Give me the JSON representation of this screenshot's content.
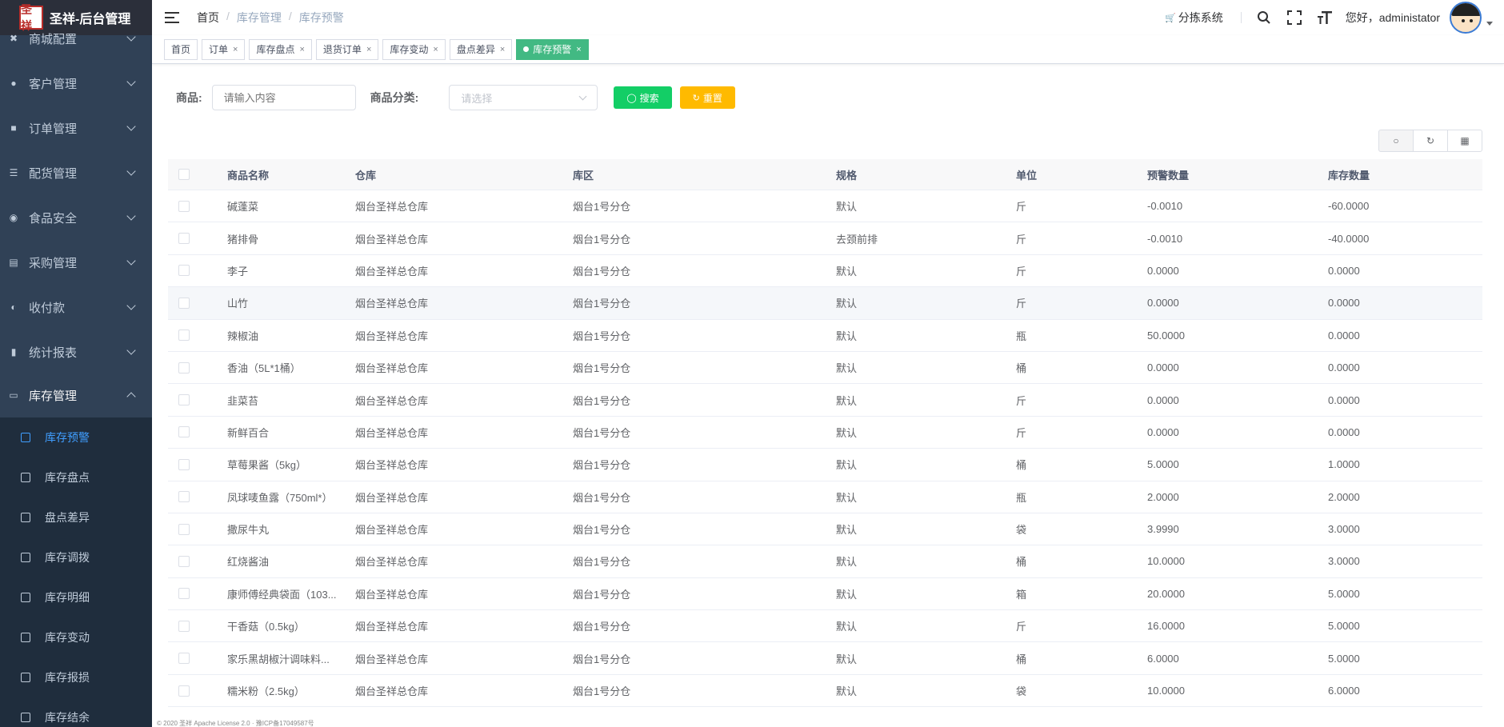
{
  "app": {
    "title": "圣祥-后台管理",
    "logo_text": "圣祥"
  },
  "sidebar": {
    "items": [
      {
        "label": "商城配置",
        "icon": "settings-icon"
      },
      {
        "label": "客户管理",
        "icon": "user-icon"
      },
      {
        "label": "订单管理",
        "icon": "lock-icon"
      },
      {
        "label": "配货管理",
        "icon": "list-icon"
      },
      {
        "label": "食品安全",
        "icon": "palette-icon"
      },
      {
        "label": "采购管理",
        "icon": "doc-icon"
      },
      {
        "label": "收付款",
        "icon": "coin-icon"
      },
      {
        "label": "统计报表",
        "icon": "chart-icon"
      },
      {
        "label": "库存管理",
        "icon": "monitor-icon"
      }
    ],
    "subitems": [
      {
        "label": "库存预警",
        "active": true
      },
      {
        "label": "库存盘点"
      },
      {
        "label": "盘点差异"
      },
      {
        "label": "库存调拨"
      },
      {
        "label": "库存明细"
      },
      {
        "label": "库存变动"
      },
      {
        "label": "库存报损"
      },
      {
        "label": "库存结余"
      }
    ]
  },
  "header": {
    "breadcrumb": [
      "首页",
      "库存管理",
      "库存预警"
    ],
    "system_link": "分拣系统",
    "greeting": "您好，administator"
  },
  "tags": [
    {
      "label": "首页",
      "closable": false
    },
    {
      "label": "订单",
      "closable": true
    },
    {
      "label": "库存盘点",
      "closable": true
    },
    {
      "label": "退货订单",
      "closable": true
    },
    {
      "label": "库存变动",
      "closable": true
    },
    {
      "label": "盘点差异",
      "closable": true
    },
    {
      "label": "库存预警",
      "closable": true,
      "active": true
    }
  ],
  "search": {
    "product_label": "商品:",
    "product_placeholder": "请输入内容",
    "category_label": "商品分类:",
    "category_placeholder": "请选择",
    "search_button": "搜索",
    "reset_button": "重置"
  },
  "table": {
    "columns": [
      "商品名称",
      "仓库",
      "库区",
      "规格",
      "单位",
      "预警数量",
      "库存数量"
    ],
    "rows": [
      [
        "碱蓬菜",
        "烟台圣祥总仓库",
        "烟台1号分仓",
        "默认",
        "斤",
        "-0.0010",
        "-60.0000"
      ],
      [
        "猪排骨",
        "烟台圣祥总仓库",
        "烟台1号分仓",
        "去颈前排",
        "斤",
        "-0.0010",
        "-40.0000"
      ],
      [
        "李子",
        "烟台圣祥总仓库",
        "烟台1号分仓",
        "默认",
        "斤",
        "0.0000",
        "0.0000"
      ],
      [
        "山竹",
        "烟台圣祥总仓库",
        "烟台1号分仓",
        "默认",
        "斤",
        "0.0000",
        "0.0000"
      ],
      [
        "辣椒油",
        "烟台圣祥总仓库",
        "烟台1号分仓",
        "默认",
        "瓶",
        "50.0000",
        "0.0000"
      ],
      [
        "香油（5L*1桶）",
        "烟台圣祥总仓库",
        "烟台1号分仓",
        "默认",
        "桶",
        "0.0000",
        "0.0000"
      ],
      [
        "韭菜苔",
        "烟台圣祥总仓库",
        "烟台1号分仓",
        "默认",
        "斤",
        "0.0000",
        "0.0000"
      ],
      [
        "新鲜百合",
        "烟台圣祥总仓库",
        "烟台1号分仓",
        "默认",
        "斤",
        "0.0000",
        "0.0000"
      ],
      [
        "草莓果酱（5kg）",
        "烟台圣祥总仓库",
        "烟台1号分仓",
        "默认",
        "桶",
        "5.0000",
        "1.0000"
      ],
      [
        "凤球唛鱼露（750ml*）",
        "烟台圣祥总仓库",
        "烟台1号分仓",
        "默认",
        "瓶",
        "2.0000",
        "2.0000"
      ],
      [
        "撒尿牛丸",
        "烟台圣祥总仓库",
        "烟台1号分仓",
        "默认",
        "袋",
        "3.9990",
        "3.0000"
      ],
      [
        "红烧酱油",
        "烟台圣祥总仓库",
        "烟台1号分仓",
        "默认",
        "桶",
        "10.0000",
        "3.0000"
      ],
      [
        "康师傅经典袋面（103...",
        "烟台圣祥总仓库",
        "烟台1号分仓",
        "默认",
        "箱",
        "20.0000",
        "5.0000"
      ],
      [
        "干香菇（0.5kg）",
        "烟台圣祥总仓库",
        "烟台1号分仓",
        "默认",
        "斤",
        "16.0000",
        "5.0000"
      ],
      [
        "家乐黑胡椒汁调味料...",
        "烟台圣祥总仓库",
        "烟台1号分仓",
        "默认",
        "桶",
        "6.0000",
        "5.0000"
      ],
      [
        "糯米粉（2.5kg）",
        "烟台圣祥总仓库",
        "烟台1号分仓",
        "默认",
        "袋",
        "10.0000",
        "6.0000"
      ]
    ]
  },
  "footer": "© 2020 圣祥 Apache License 2.0 · 豫ICP备17049587号"
}
